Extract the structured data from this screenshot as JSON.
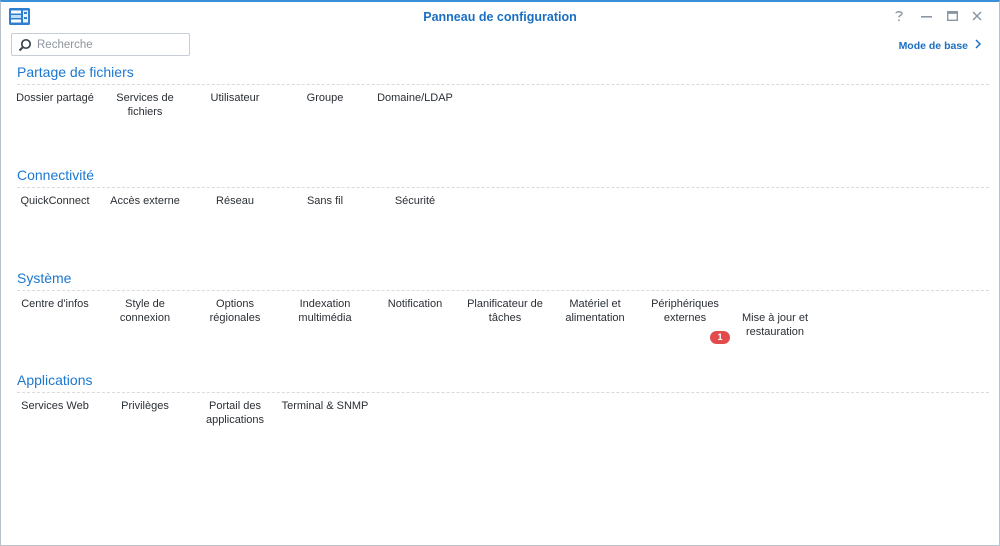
{
  "window": {
    "title": "Panneau de configuration"
  },
  "search": {
    "placeholder": "Recherche"
  },
  "header": {
    "mode_label": "Mode de base"
  },
  "sections": [
    {
      "title": "Partage de fichiers",
      "items": [
        {
          "label": "Dossier partagé"
        },
        {
          "label": "Services de fichiers"
        },
        {
          "label": "Utilisateur"
        },
        {
          "label": "Groupe"
        },
        {
          "label": "Domaine/LDAP"
        }
      ]
    },
    {
      "title": "Connectivité",
      "items": [
        {
          "label": "QuickConnect"
        },
        {
          "label": "Accès externe"
        },
        {
          "label": "Réseau"
        },
        {
          "label": "Sans fil"
        },
        {
          "label": "Sécurité"
        }
      ]
    },
    {
      "title": "Système",
      "items": [
        {
          "label": "Centre d'infos"
        },
        {
          "label": "Style de connexion"
        },
        {
          "label": "Options régionales"
        },
        {
          "label": "Indexation multimédia"
        },
        {
          "label": "Notification"
        },
        {
          "label": "Planificateur de tâches"
        },
        {
          "label": "Matériel et alimentation"
        },
        {
          "label": "Périphériques externes"
        },
        {
          "label": "Mise à jour et restauration",
          "badge": "1"
        }
      ]
    },
    {
      "title": "Applications",
      "items": [
        {
          "label": "Services Web"
        },
        {
          "label": "Privilèges"
        },
        {
          "label": "Portail des applications"
        },
        {
          "label": "Terminal & SNMP"
        }
      ]
    }
  ],
  "colors": {
    "accent": "#1b78d0",
    "badge": "#e24b4b"
  },
  "icons": {
    "app": "control-panel-icon",
    "help": "help-icon",
    "minimize": "minimize-icon",
    "maximize": "maximize-icon",
    "close": "close-icon",
    "search": "search-icon",
    "chevron": "chevron-right-icon"
  }
}
